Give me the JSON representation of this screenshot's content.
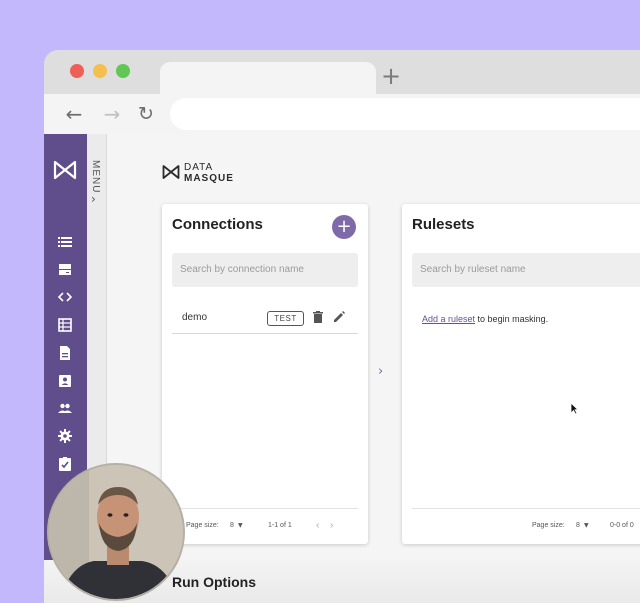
{
  "app": {
    "brand_line1": "DATA",
    "brand_line2": "MASQUE",
    "menu_label": "MENU",
    "sidebar_icons": [
      "list-icon",
      "database-icon",
      "code-icon",
      "table-icon",
      "document-icon",
      "contact-card-icon",
      "users-icon",
      "settings-icon",
      "clipboard-check-icon"
    ]
  },
  "connections": {
    "title": "Connections",
    "search_placeholder": "Search by connection name",
    "rows": [
      {
        "name": "demo",
        "test_label": "TEST"
      }
    ],
    "page_size_label": "Page size:",
    "page_size_value": "8",
    "range": "1-1 of 1"
  },
  "rulesets": {
    "title": "Rulesets",
    "search_placeholder": "Search by ruleset name",
    "empty_link": "Add a ruleset",
    "empty_text": " to begin masking.",
    "page_size_label": "Page size:",
    "page_size_value": "8",
    "range": "0-0 of 0"
  },
  "run_options": {
    "title": "Run Options"
  },
  "colors": {
    "sidebar": "#5f4e8b",
    "accent": "#7e6aa8",
    "background": "#c3b8fb"
  }
}
